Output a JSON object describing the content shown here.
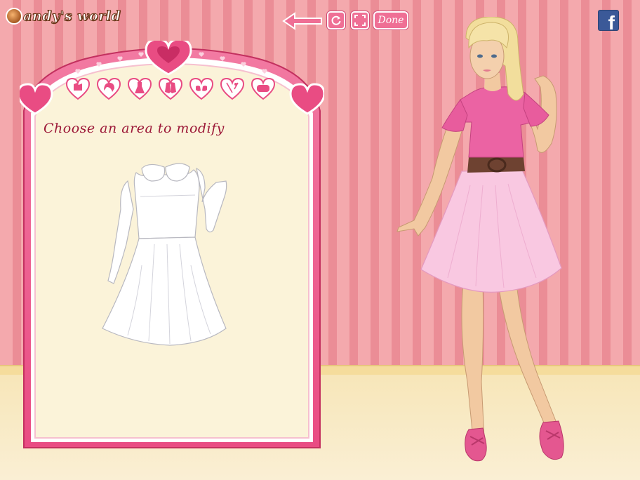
{
  "header": {
    "logo_text": "andy's world",
    "done_label": "Done"
  },
  "panel": {
    "instruction": "Choose an area to modify",
    "categories": [
      {
        "name": "outfit-category-icon"
      },
      {
        "name": "hair-category-icon"
      },
      {
        "name": "dress-category-icon"
      },
      {
        "name": "jacket-category-icon"
      },
      {
        "name": "shoes-category-icon"
      },
      {
        "name": "necklace-category-icon"
      },
      {
        "name": "bag-category-icon"
      }
    ]
  },
  "colors": {
    "frame_pink": "#e94c83",
    "panel_cream": "#fbf3d9",
    "accent": "#ef6f95",
    "text": "#9c1838"
  }
}
